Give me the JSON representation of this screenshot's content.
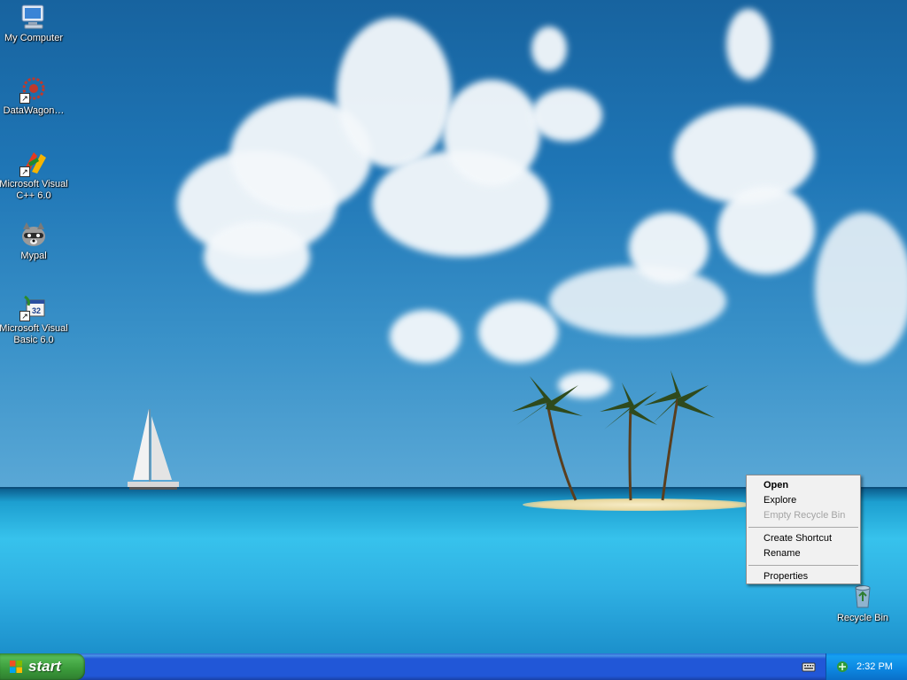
{
  "desktop": {
    "icons": [
      {
        "name": "My Computer",
        "icon": "my-computer-icon"
      },
      {
        "name": "DataWagon…",
        "icon": "datawagon-icon"
      },
      {
        "name": "Microsoft Visual C++ 6.0",
        "line1": "Microsoft Visual",
        "line2": "C++ 6.0",
        "icon": "visual-cpp-icon"
      },
      {
        "name": "Mypal",
        "icon": "mypal-raccoon-icon"
      },
      {
        "name": "Microsoft Visual Basic 6.0",
        "line1": "Microsoft Visual",
        "line2": "Basic 6.0",
        "icon": "visual-basic-icon"
      }
    ],
    "recycle_bin": {
      "name": "Recycle Bin",
      "icon": "recycle-bin-icon"
    }
  },
  "context_menu": {
    "items": [
      {
        "label": "Open",
        "bold": true
      },
      {
        "label": "Explore"
      },
      {
        "label": "Empty Recycle Bin",
        "disabled": true
      },
      {
        "label": "Create Shortcut"
      },
      {
        "label": "Rename"
      },
      {
        "label": "Properties"
      }
    ]
  },
  "taskbar": {
    "start_label": "start",
    "clock": "2:32 PM"
  },
  "colors": {
    "taskbar_blue": "#2157d7",
    "start_green": "#3a9a3a",
    "tray_blue": "#0c86e0",
    "menu_bg": "#f1f1f1"
  }
}
